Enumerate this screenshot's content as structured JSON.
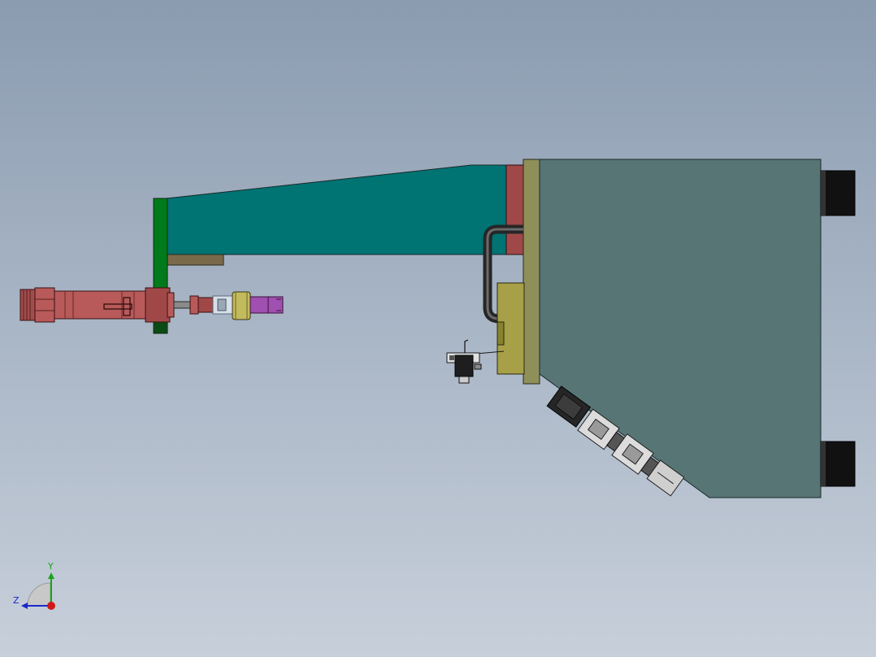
{
  "triad": {
    "y_label": "Y",
    "z_label": "Z",
    "y_color": "#1aa31a",
    "z_color": "#1a28c8",
    "x_color": "#d01818"
  },
  "colors": {
    "arm": "#007373",
    "housing": "#577575",
    "mount_plate": "#007a1a",
    "flange": "#a04848",
    "adapter_plate": "#8f8f5a",
    "cylinder": "#b85a5a",
    "tip": "#a050b0",
    "nut": "#c2bb5e",
    "bracket": "#7a6a4a",
    "roller_housing": "#2f2f2f",
    "hose": "#3a3a3a"
  }
}
